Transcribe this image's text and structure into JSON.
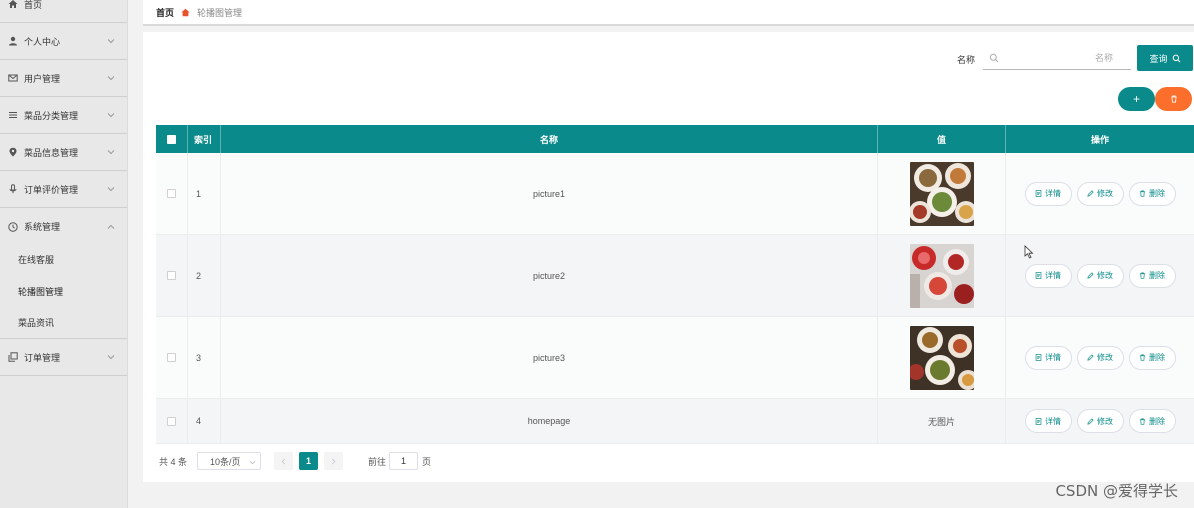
{
  "sidebar": {
    "items": [
      {
        "label": "首页",
        "icon": "home-icon"
      },
      {
        "label": "个人中心",
        "icon": "user-icon"
      },
      {
        "label": "用户管理",
        "icon": "mail-icon"
      },
      {
        "label": "菜品分类管理",
        "icon": "list-icon"
      },
      {
        "label": "菜品信息管理",
        "icon": "pin-icon"
      },
      {
        "label": "订单评价管理",
        "icon": "mic-icon"
      },
      {
        "label": "系统管理",
        "icon": "clock-icon"
      }
    ],
    "sub_items": [
      {
        "label": "在线客服"
      },
      {
        "label": "轮播图管理"
      },
      {
        "label": "菜品资讯"
      }
    ],
    "last_item": {
      "label": "订单管理",
      "icon": "copy-icon"
    }
  },
  "breadcrumb": {
    "home": "首页",
    "current": "轮播图管理"
  },
  "search": {
    "label": "名称",
    "placeholder": "名称",
    "button_label": "查询"
  },
  "actions": {
    "add_label": "+"
  },
  "table": {
    "headers": {
      "index": "索引",
      "name": "名称",
      "value": "值",
      "ops": "操作"
    },
    "rows": [
      {
        "index": "1",
        "name": "picture1",
        "value_text": ""
      },
      {
        "index": "2",
        "name": "picture2",
        "value_text": ""
      },
      {
        "index": "3",
        "name": "picture3",
        "value_text": ""
      },
      {
        "index": "4",
        "name": "homepage",
        "value_text": "无图片"
      }
    ],
    "op_labels": {
      "detail": "详情",
      "edit": "修改",
      "delete": "删除"
    }
  },
  "pagination": {
    "total": "共 4 条",
    "page_size": "10条/页",
    "current_page": "1",
    "goto_label": "前往",
    "goto_value": "1",
    "page_suffix": "页"
  },
  "watermark": "CSDN @爱得学长",
  "colors": {
    "primary": "#0a8a8a",
    "danger": "#fb6e2b",
    "breadcrumb_icon": "#e8532b"
  }
}
